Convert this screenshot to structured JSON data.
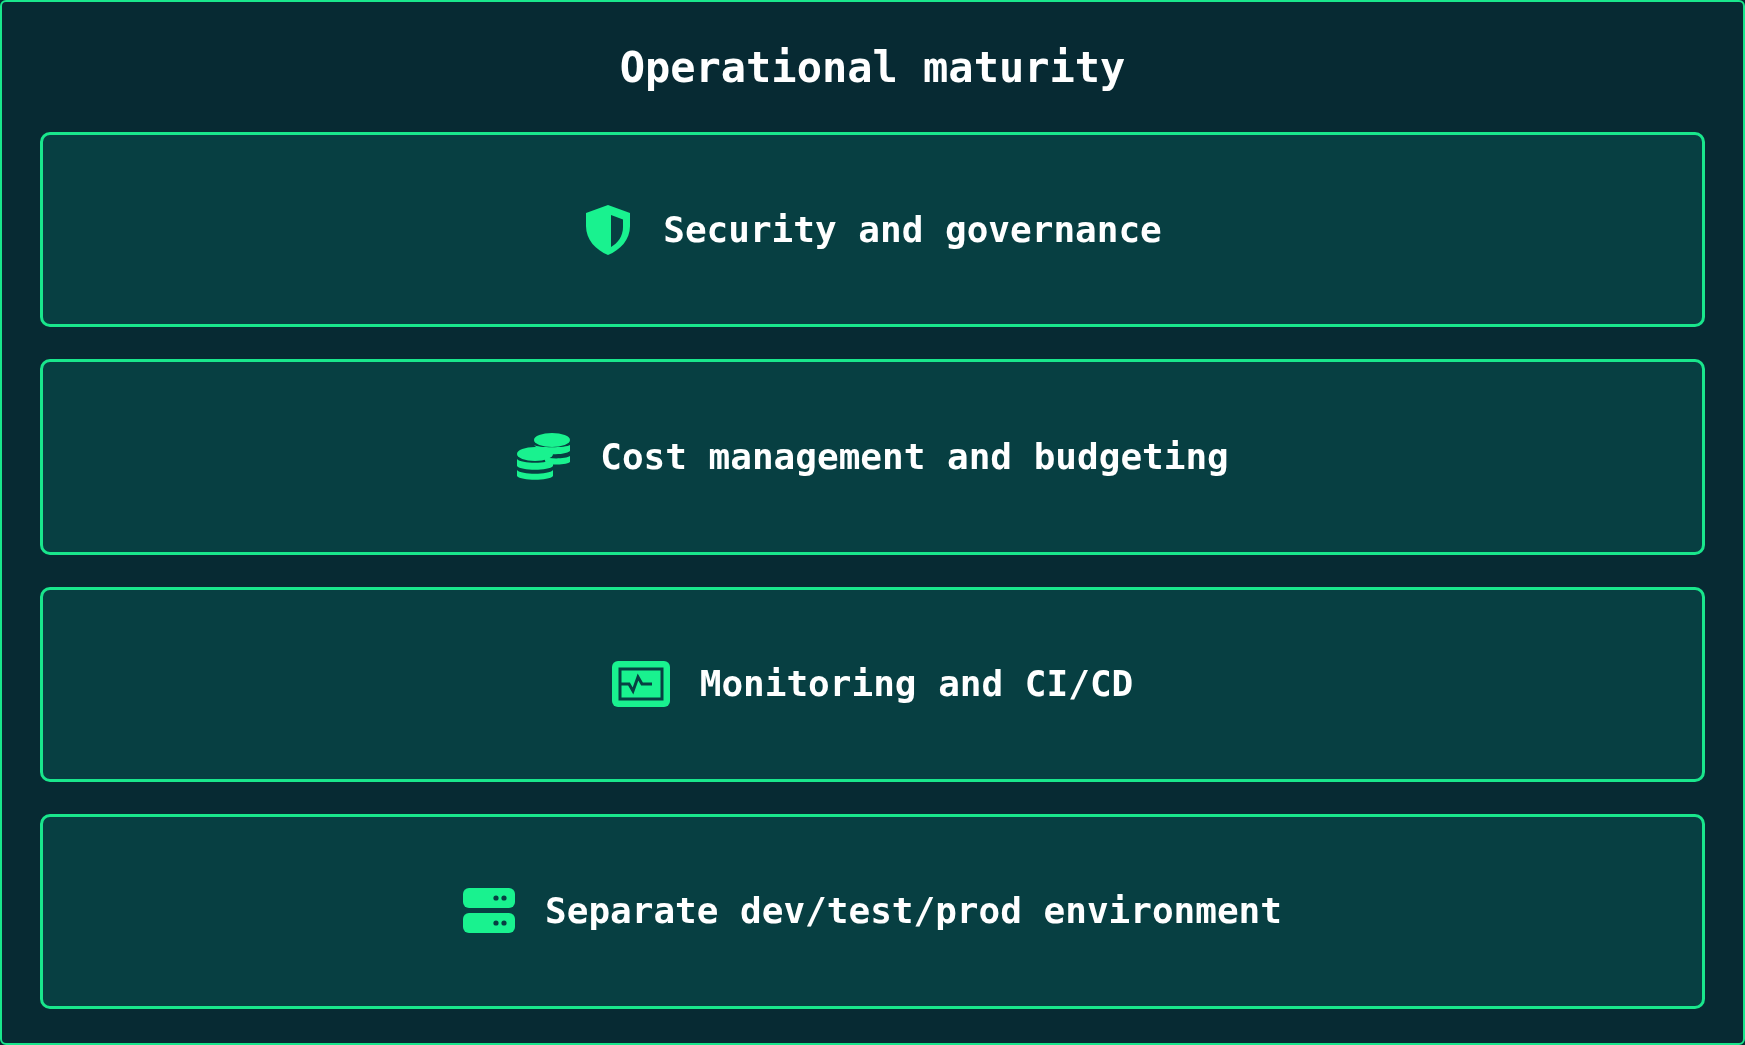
{
  "title": "Operational maturity",
  "items": [
    {
      "label": "Security and governance",
      "kind": "shield"
    },
    {
      "label": "Cost management and budgeting",
      "kind": "coins"
    },
    {
      "label": "Monitoring and CI/CD",
      "kind": "monitor"
    },
    {
      "label": "Separate dev/test/prod environment",
      "kind": "server"
    }
  ]
}
